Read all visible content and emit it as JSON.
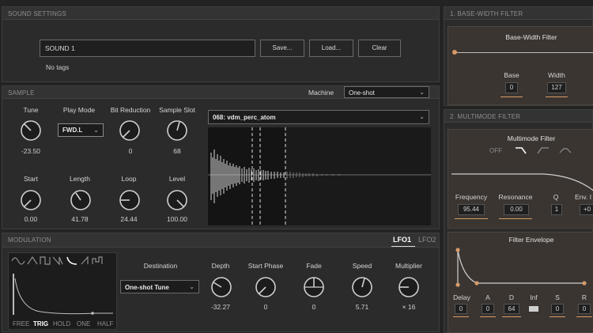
{
  "sound": {
    "header": "SOUND SETTINGS",
    "name_value": "SOUND 1",
    "save_label": "Save...",
    "load_label": "Load...",
    "clear_label": "Clear",
    "tags_text": "No tags"
  },
  "sample": {
    "header": "SAMPLE",
    "machine_label": "Machine",
    "machine_value": "One-shot",
    "sample_name": "068: vdm_perc_atom",
    "play_mode_value": "FWD.L",
    "knobs": [
      {
        "label": "Tune",
        "value": "-23.50"
      },
      {
        "label": "Play Mode",
        "value": ""
      },
      {
        "label": "Bit Reduction",
        "value": "0"
      },
      {
        "label": "Sample Slot",
        "value": "68"
      },
      {
        "label": "Start",
        "value": "0.00"
      },
      {
        "label": "Length",
        "value": "41.78"
      },
      {
        "label": "Loop",
        "value": "24.44"
      },
      {
        "label": "Level",
        "value": "100.00"
      }
    ]
  },
  "modulation": {
    "header": "MODULATION",
    "tabs": [
      "LFO1",
      "LFO2"
    ],
    "destination_label": "Destination",
    "destination_value": "One-shot Tune",
    "modes": [
      "FREE",
      "TRIG",
      "HOLD",
      "ONE",
      "HALF"
    ],
    "knobs": [
      {
        "label": "Depth",
        "value": "-32.27"
      },
      {
        "label": "Start Phase",
        "value": "0"
      },
      {
        "label": "Fade",
        "value": "0"
      },
      {
        "label": "Speed",
        "value": "5.71"
      },
      {
        "label": "Multiplier",
        "value": "× 16"
      }
    ]
  },
  "base_width": {
    "header": "1. BASE-WIDTH FILTER",
    "title": "Base-Width Filter",
    "base_label": "Base",
    "base_value": "0",
    "width_label": "Width",
    "width_value": "127"
  },
  "multimode": {
    "header": "2. MULTIMODE FILTER",
    "title": "Multimode Filter",
    "off_label": "OFF",
    "frequency_label": "Frequency",
    "frequency_value": "95.44",
    "resonance_label": "Resonance",
    "resonance_value": "0.00",
    "q_label": "Q",
    "q_value": "1",
    "env_label": "Env. I",
    "env_value": "+0",
    "envelope_title": "Filter Envelope",
    "env_params": [
      {
        "label": "Delay",
        "value": "0"
      },
      {
        "label": "A",
        "value": "0"
      },
      {
        "label": "D",
        "value": "64"
      },
      {
        "label": "Inf",
        "value": ""
      },
      {
        "label": "S",
        "value": "0"
      },
      {
        "label": "R",
        "value": "0"
      }
    ]
  },
  "colors": {
    "accent": "#d79a67",
    "panel": "#2b2b2b",
    "background": "#232323"
  }
}
